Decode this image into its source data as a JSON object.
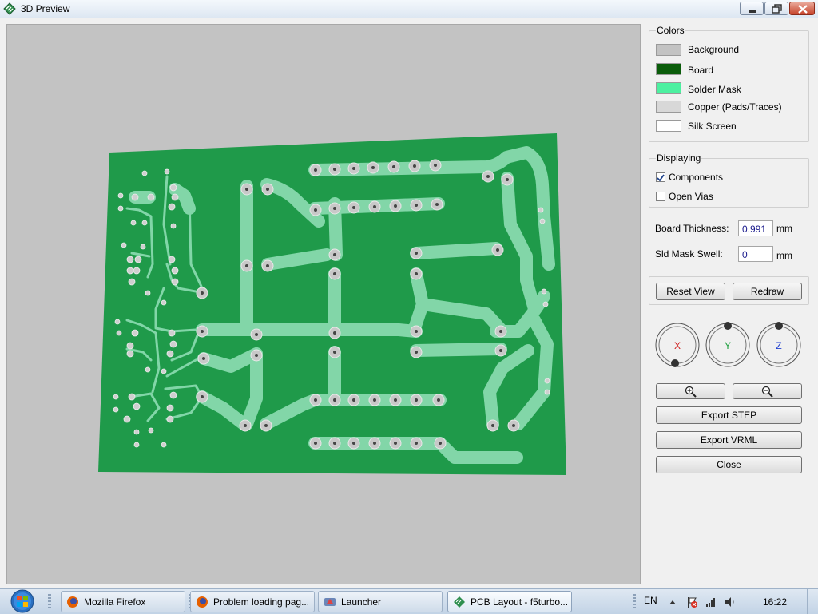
{
  "window": {
    "title": "3D Preview"
  },
  "colors_group": {
    "title": "Colors",
    "items": [
      {
        "label": "Background",
        "color": "#c3c3c3"
      },
      {
        "label": "Board",
        "color": "#0a5c0a"
      },
      {
        "label": "Solder Mask",
        "color": "#4cf0a0"
      },
      {
        "label": "Copper (Pads/Traces)",
        "color": "#d8d8d8"
      },
      {
        "label": "Silk Screen",
        "color": "#ffffff"
      }
    ]
  },
  "displaying_group": {
    "title": "Displaying",
    "components": {
      "label": "Components",
      "checked": true
    },
    "open_vias": {
      "label": "Open Vias",
      "checked": false
    }
  },
  "board_thickness": {
    "label": "Board Thickness:",
    "value": "0.991",
    "unit": "mm"
  },
  "sld_mask_swell": {
    "label": "Sld Mask Swell:",
    "value": "0",
    "unit": "mm"
  },
  "buttons": {
    "reset_view": "Reset View",
    "redraw": "Redraw",
    "export_step": "Export STEP",
    "export_vrml": "Export VRML",
    "close": "Close"
  },
  "axes": {
    "x": "X",
    "y": "Y",
    "z": "Z"
  },
  "taskbar": {
    "items": [
      {
        "label": "Mozilla Firefox",
        "icon": "firefox-icon"
      },
      {
        "label": "Problem loading pag...",
        "icon": "firefox-icon"
      },
      {
        "label": "Launcher",
        "icon": "launcher-icon"
      },
      {
        "label": "PCB Layout - f5turbo...",
        "icon": "pcb-icon"
      }
    ],
    "language": "EN",
    "clock": "16:22"
  },
  "theme": {
    "board_green": "#1f9a4a",
    "trace_color": "#82d6a8",
    "axis_x": "#d02020",
    "axis_y": "#20a040",
    "axis_z": "#2040d0"
  }
}
